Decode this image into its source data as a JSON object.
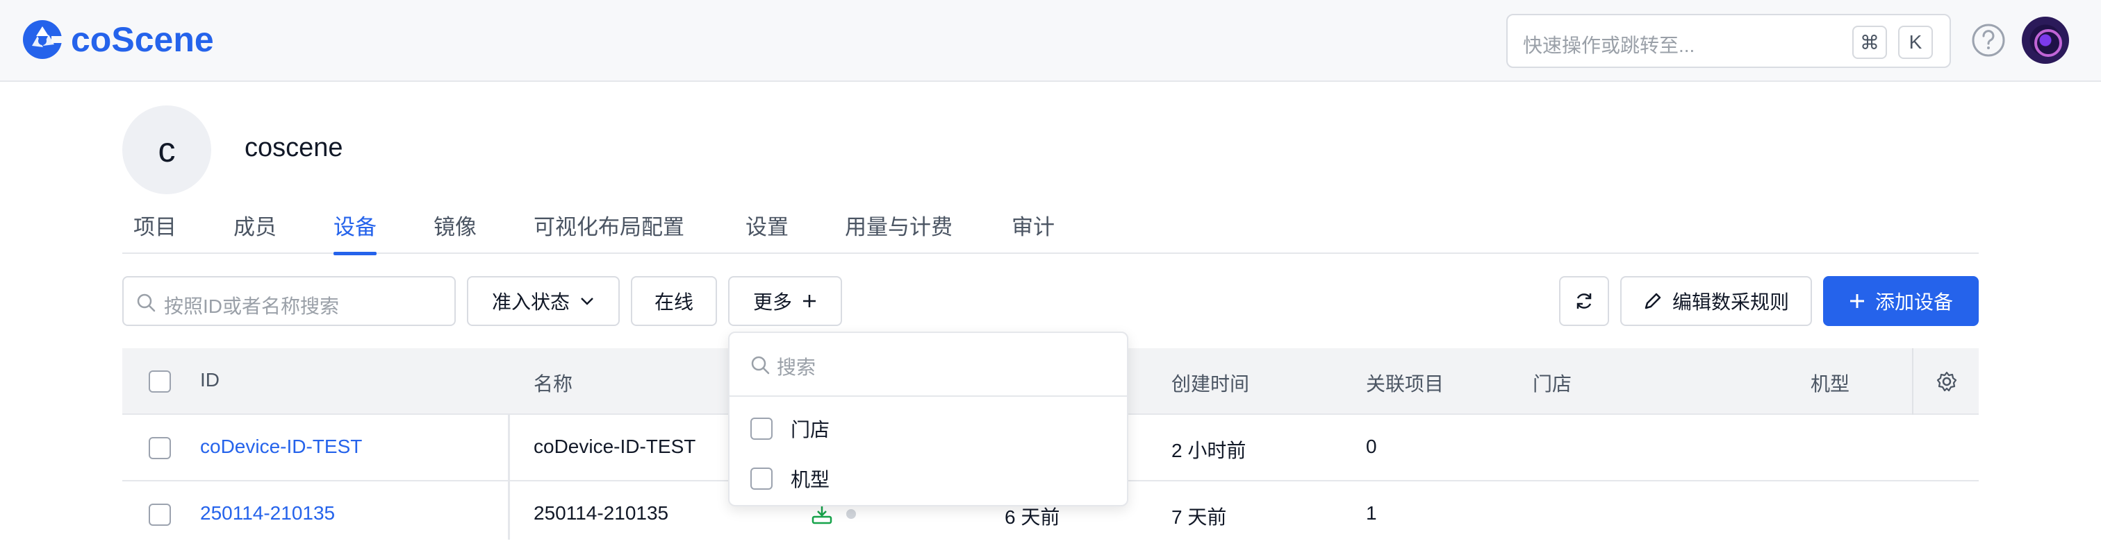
{
  "brand": {
    "name": "coScene",
    "accent": "#2563eb"
  },
  "command_bar": {
    "placeholder": "快速操作或跳转至...",
    "key1": "⌘",
    "key2": "K"
  },
  "org": {
    "initial": "c",
    "name": "coscene"
  },
  "tabs": [
    {
      "label": "项目"
    },
    {
      "label": "成员"
    },
    {
      "label": "设备",
      "active": true
    },
    {
      "label": "镜像"
    },
    {
      "label": "可视化布局配置"
    },
    {
      "label": "设置"
    },
    {
      "label": "用量与计费"
    },
    {
      "label": "审计"
    }
  ],
  "toolbar": {
    "search_placeholder": "按照ID或者名称搜索",
    "filter_status": "准入状态",
    "filter_online": "在线",
    "more": "更多",
    "edit_rules": "编辑数采规则",
    "add_device": "添加设备"
  },
  "table": {
    "columns": {
      "id": "ID",
      "name": "名称",
      "created": "创建时间",
      "projects": "关联项目",
      "store": "门店",
      "model": "机型"
    },
    "rows": [
      {
        "id": "coDevice-ID-TEST",
        "name": "coDevice-ID-TEST",
        "last_seen": "",
        "created": "2 小时前",
        "projects": "0"
      },
      {
        "id": "250114-210135",
        "name": "250114-210135",
        "last_seen": "6 天前",
        "created": "7 天前",
        "projects": "1"
      }
    ]
  },
  "dropdown": {
    "search_placeholder": "搜索",
    "options": [
      {
        "label": "门店"
      },
      {
        "label": "机型"
      }
    ]
  }
}
